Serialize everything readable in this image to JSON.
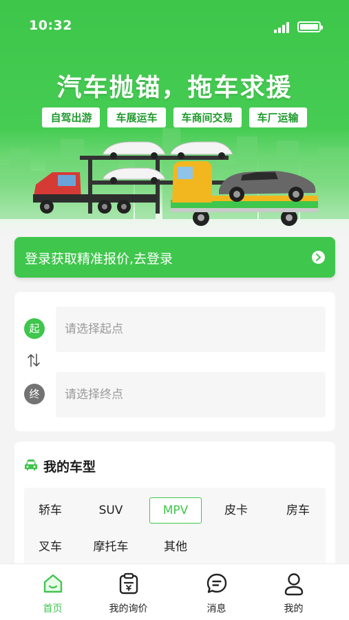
{
  "status_bar": {
    "time": "10:32"
  },
  "hero": {
    "title": "汽车抛锚，拖车求援",
    "tags": [
      "自驾出游",
      "车展运车",
      "车商间交易",
      "车厂运输"
    ]
  },
  "login_banner": {
    "text": "登录获取精准报价,去登录"
  },
  "route": {
    "start_badge": "起",
    "end_badge": "终",
    "start_placeholder": "请选择起点",
    "end_placeholder": "请选择终点"
  },
  "vehicle": {
    "title": "我的车型",
    "types": [
      "轿车",
      "SUV",
      "MPV",
      "皮卡",
      "房车",
      "叉车",
      "摩托车",
      "其他"
    ],
    "selected": "MPV"
  },
  "nav": {
    "items": [
      {
        "label": "首页",
        "icon": "home-icon",
        "active": true
      },
      {
        "label": "我的询价",
        "icon": "clipboard-quote-icon",
        "active": false
      },
      {
        "label": "消息",
        "icon": "message-icon",
        "active": false
      },
      {
        "label": "我的",
        "icon": "person-icon",
        "active": false
      }
    ]
  },
  "colors": {
    "accent": "#3fc64c",
    "end_badge": "#737373",
    "page_bg": "#f3f4f3"
  }
}
